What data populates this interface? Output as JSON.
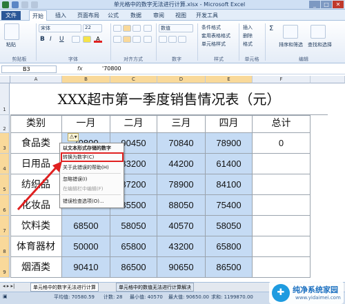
{
  "window": {
    "title": "单元格中的数字无法进行计算.xlsx - Microsoft Excel"
  },
  "ribbon_tabs": {
    "file": "文件",
    "tabs": [
      "开始",
      "插入",
      "页面布局",
      "公式",
      "数据",
      "审阅",
      "视图",
      "开发工具"
    ]
  },
  "ribbon": {
    "clipboard": {
      "paste": "粘贴",
      "label": "剪贴板"
    },
    "font": {
      "name": "宋体",
      "size": "22",
      "label": "字体"
    },
    "alignment": {
      "label": "对齐方式"
    },
    "number": {
      "format": "数值",
      "label": "数字"
    },
    "styles": {
      "conditional": "条件格式",
      "table": "套用表格格式",
      "cell": "单元格样式",
      "label": "样式"
    },
    "cells": {
      "insert": "插入",
      "delete": "删除",
      "format": "格式",
      "label": "单元格"
    },
    "editing": {
      "sort": "排序和筛选",
      "find": "查找和选择",
      "label": "编辑"
    }
  },
  "formula_bar": {
    "name_box": "B3",
    "fx": "fx",
    "value": "'70800"
  },
  "columns": [
    "A",
    "B",
    "C",
    "D",
    "E",
    "F"
  ],
  "rows": [
    "1",
    "2",
    "3",
    "4",
    "5",
    "6",
    "7",
    "8",
    "9"
  ],
  "sheet": {
    "title": "XXX超市第一季度销售情况表（元）",
    "headers": [
      "类别",
      "一月",
      "二月",
      "三月",
      "四月",
      "总计"
    ],
    "data": [
      [
        "食品类",
        "70800",
        "90450",
        "70840",
        "78900",
        "0"
      ],
      [
        "日用品",
        "",
        "83200",
        "44200",
        "61400",
        ""
      ],
      [
        "纺织品",
        "",
        "87200",
        "78900",
        "84100",
        ""
      ],
      [
        "化妆品",
        "",
        "85500",
        "88050",
        "75400",
        ""
      ],
      [
        "饮料类",
        "68500",
        "58050",
        "40570",
        "58050",
        ""
      ],
      [
        "体育器材",
        "50000",
        "65800",
        "43200",
        "65800",
        ""
      ],
      [
        "烟酒类",
        "90410",
        "86500",
        "90650",
        "86500",
        ""
      ]
    ]
  },
  "context_menu": {
    "items": [
      "以文本形式存储的数字",
      "转换为数字(C)",
      "关于此错误的帮助(H)",
      "忽略错误(I)",
      "在编辑栏中编辑(F)",
      "错误检查选项(O)..."
    ]
  },
  "sheet_tabs": [
    "单元格中的数字无法进行计算",
    "单元格中的数值无法进行计算解决"
  ],
  "status": {
    "average": "平均值: 70580.59",
    "count": "计数: 28",
    "min": "最小值: 40570",
    "max": "最大值: 90650.00",
    "sum": "求和: 1199870.00"
  },
  "watermark": {
    "title": "纯净系统家园",
    "url": "www.yidaimei.com"
  },
  "colors": {
    "selection": "#c5dbf4",
    "highlight_box": "#e02020",
    "accent": "#2b5797"
  }
}
